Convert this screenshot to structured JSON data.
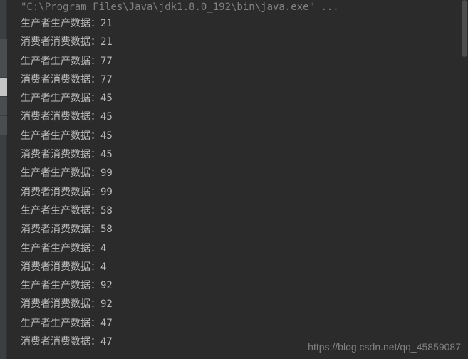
{
  "command_line": "\"C:\\Program Files\\Java\\jdk1.8.0_192\\bin\\java.exe\" ...",
  "producer_label": "生产者生产数据：",
  "consumer_label": "消费者消费数据：",
  "lines": [
    {
      "type": "producer",
      "value": "21"
    },
    {
      "type": "consumer",
      "value": "21"
    },
    {
      "type": "producer",
      "value": "77"
    },
    {
      "type": "consumer",
      "value": "77"
    },
    {
      "type": "producer",
      "value": "45"
    },
    {
      "type": "consumer",
      "value": "45"
    },
    {
      "type": "producer",
      "value": "45"
    },
    {
      "type": "consumer",
      "value": "45"
    },
    {
      "type": "producer",
      "value": "99"
    },
    {
      "type": "consumer",
      "value": "99"
    },
    {
      "type": "producer",
      "value": "58"
    },
    {
      "type": "consumer",
      "value": "58"
    },
    {
      "type": "producer",
      "value": "4"
    },
    {
      "type": "consumer",
      "value": "4"
    },
    {
      "type": "producer",
      "value": "92"
    },
    {
      "type": "consumer",
      "value": "92"
    },
    {
      "type": "producer",
      "value": "47"
    },
    {
      "type": "consumer",
      "value": "47"
    }
  ],
  "watermark": "https://blog.csdn.net/qq_45859087"
}
